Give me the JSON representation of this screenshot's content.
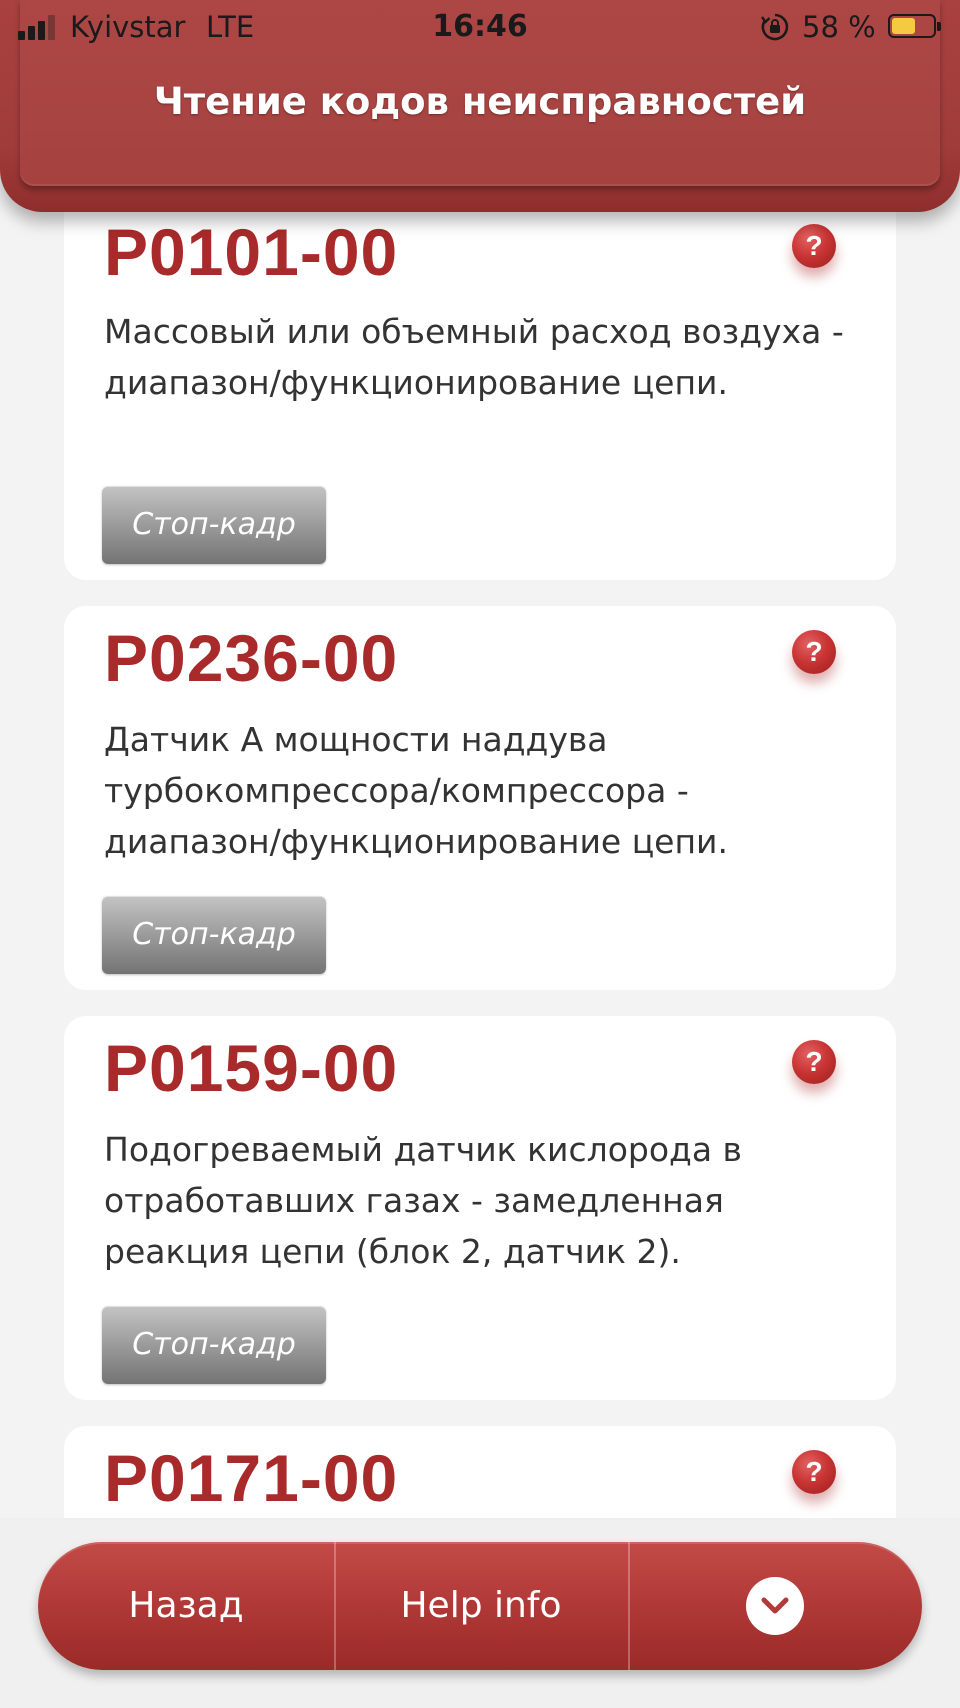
{
  "status_bar": {
    "carrier": "Kyivstar",
    "network": "LTE",
    "time": "16:46",
    "battery_percent": "58 %",
    "battery_level": 0.58,
    "icons": [
      "signal-icon",
      "orientation-lock-icon",
      "battery-icon"
    ]
  },
  "header": {
    "title": "Чтение кодов неисправностей"
  },
  "codes": [
    {
      "code": "P0101-00",
      "description": "Массовый или объемный расход воздуха - диапазон/функционирование цепи.",
      "help_glyph": "?",
      "freeze_frame_label": "Стоп-кадр"
    },
    {
      "code": "P0236-00",
      "description": "Датчик A мощности наддува турбокомпрессора/компрессора - диапазон/функционирование цепи.",
      "help_glyph": "?",
      "freeze_frame_label": "Стоп-кадр"
    },
    {
      "code": "P0159-00",
      "description": "Подогреваемый датчик кислорода в отработавших газах - замедленная реакция цепи (блок 2, датчик 2).",
      "help_glyph": "?",
      "freeze_frame_label": "Стоп-кадр"
    },
    {
      "code": "P0171-00",
      "help_glyph": "?"
    }
  ],
  "toolbar": {
    "back_label": "Назад",
    "help_label": "Help info",
    "more_icon": "chevron-down-icon"
  },
  "colors": {
    "accent": "#a82a2a",
    "header": "#a54240",
    "toolbar": "#b23a38"
  }
}
